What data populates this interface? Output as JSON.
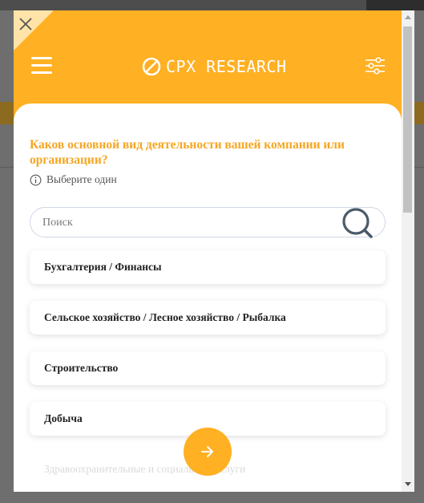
{
  "header": {
    "logo_text": "CPX RESEARCH"
  },
  "question": {
    "text": "Каков основной вид деятельности вашей компании или организации?",
    "hint": "Выберите один"
  },
  "search": {
    "placeholder": "Поиск",
    "value": ""
  },
  "options": [
    {
      "label": "Бухгалтерия / Финансы"
    },
    {
      "label": "Сельское хозяйство / Лесное хозяйство / Рыбалка"
    },
    {
      "label": "Строительство"
    },
    {
      "label": "Добыча"
    },
    {
      "label": "Здравоохранительные и социальные услуги"
    }
  ],
  "colors": {
    "brand": "#ffb023",
    "question_text": "#f5a623"
  },
  "icons": [
    "close-icon",
    "menu-icon",
    "cpx-logo-icon",
    "filter-icon",
    "info-icon",
    "search-icon",
    "arrow-right-icon"
  ]
}
